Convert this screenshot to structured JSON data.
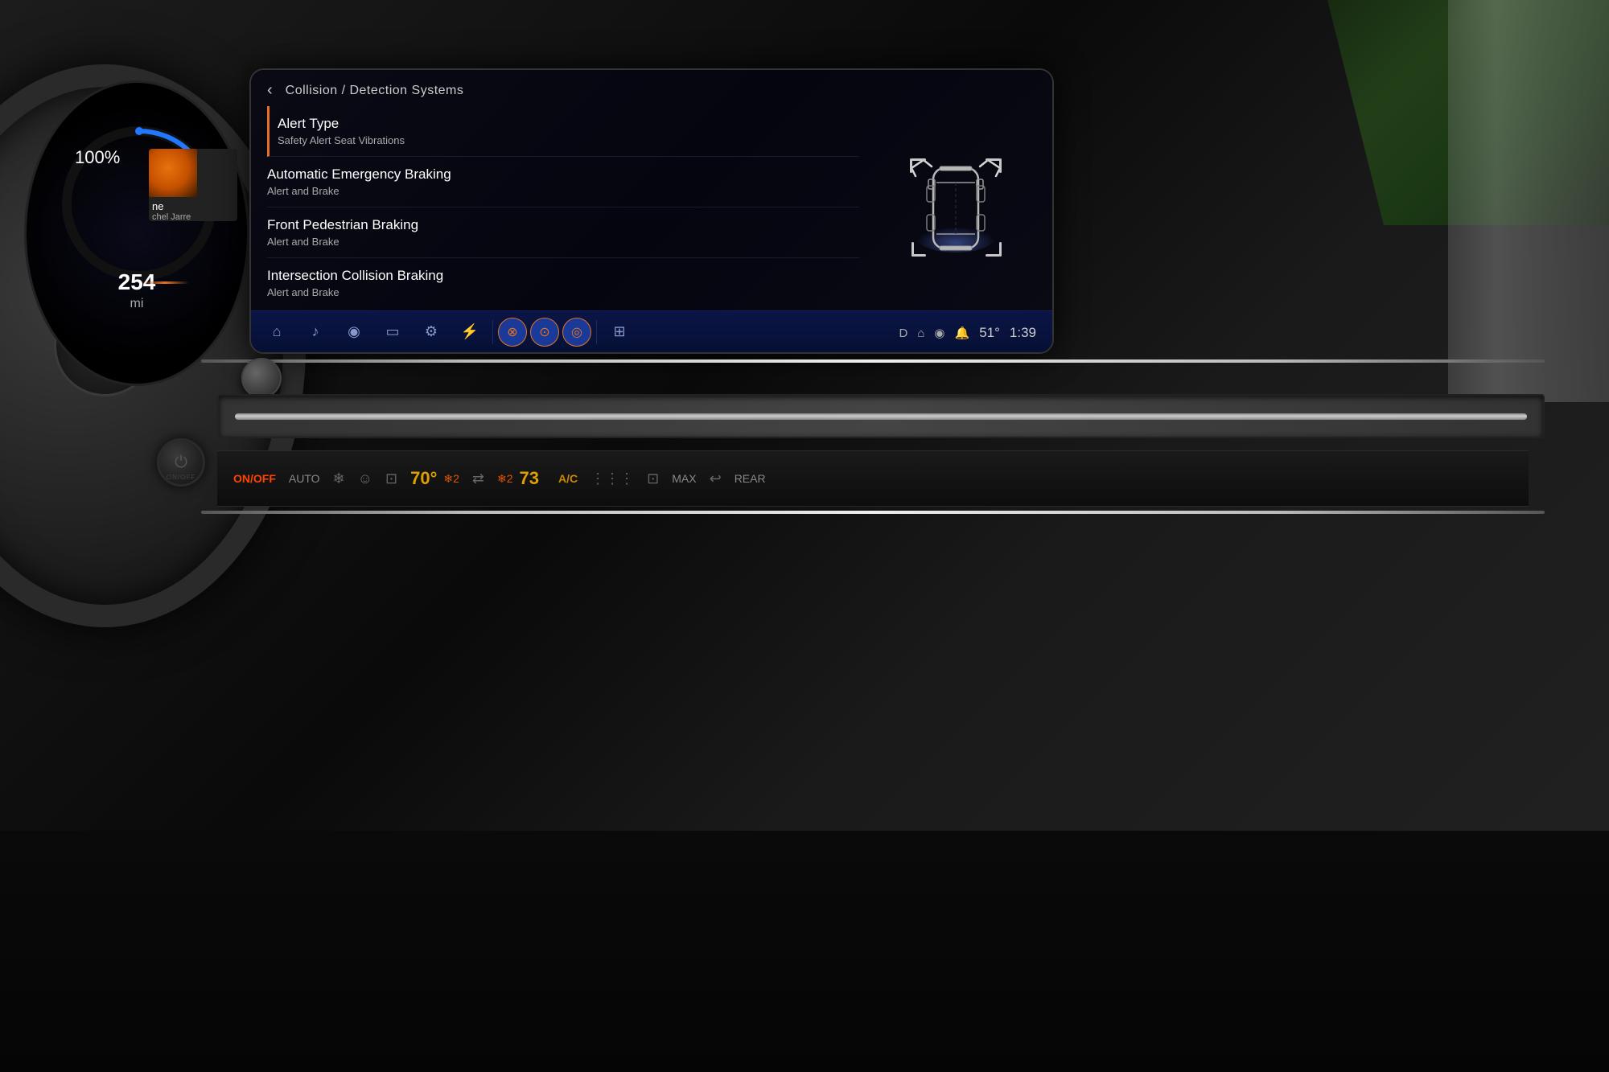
{
  "screen": {
    "title": "Collision / Detection Systems",
    "back_label": "‹",
    "menu_items": [
      {
        "id": "alert-type",
        "title": "Alert Type",
        "subtitle": "Safety Alert Seat Vibrations",
        "active": true
      },
      {
        "id": "auto-emergency",
        "title": "Automatic Emergency Braking",
        "subtitle": "Alert and Brake",
        "active": false
      },
      {
        "id": "front-pedestrian",
        "title": "Front Pedestrian Braking",
        "subtitle": "Alert and Brake",
        "active": false
      },
      {
        "id": "intersection-collision",
        "title": "Intersection Collision Braking",
        "subtitle": "Alert and Brake",
        "active": false
      }
    ],
    "nav_items": [
      {
        "id": "home",
        "icon": "⌂",
        "active": false
      },
      {
        "id": "music",
        "icon": "♪",
        "active": false
      },
      {
        "id": "nav",
        "icon": "◉",
        "active": false
      },
      {
        "id": "phone",
        "icon": "▭",
        "active": false
      },
      {
        "id": "settings",
        "icon": "⚙",
        "active": false
      },
      {
        "id": "power",
        "icon": "⚡",
        "active": false
      },
      {
        "id": "collision1",
        "icon": "⊗",
        "active": true
      },
      {
        "id": "collision2",
        "icon": "⊙",
        "active": true
      },
      {
        "id": "collision3",
        "icon": "◎",
        "active": true
      },
      {
        "id": "split",
        "icon": "⊞",
        "active": false
      }
    ],
    "status": {
      "drive_mode": "D",
      "home_icon": "⌂",
      "location_icon": "◉",
      "bell_icon": "🔔",
      "temperature": "51°",
      "time": "1:39"
    }
  },
  "cluster": {
    "percent": "100%",
    "miles": "254",
    "unit": "mi",
    "media_title": "ne",
    "media_artist": "chel Jarre"
  },
  "hvac": {
    "power_label": "ON/OFF",
    "mode_label": "AUTO",
    "left_temp": "70°",
    "right_temp": "73",
    "ac_label": "A/C",
    "max_label": "MAX",
    "rear_label": "REAR",
    "fan_left": "❄2",
    "fan_right": "❄2"
  },
  "car_diagram": {
    "description": "Vehicle top-down view with collision sensors"
  },
  "icons": {
    "back": "‹",
    "home": "⌂",
    "music_note": "♪",
    "location_pin": "◉",
    "phone": "▭",
    "settings": "⚙",
    "lightning": "⚡",
    "no_entry": "⊗",
    "circle_dot": "⊙",
    "target": "◎",
    "grid": "⊞",
    "bell": "🔔",
    "power": "⏻"
  }
}
